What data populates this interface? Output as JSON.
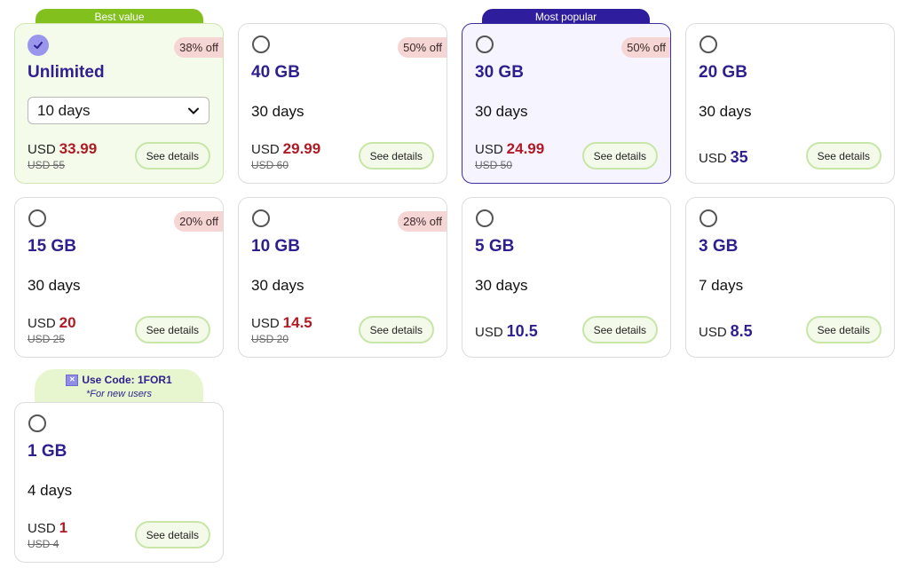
{
  "badges": {
    "best_value": "Best value",
    "most_popular": "Most popular"
  },
  "promo": {
    "code_text": "Use Code: 1FOR1",
    "note": "*For new users",
    "icon": "close-icon"
  },
  "common": {
    "currency": "USD",
    "details_label": "See details"
  },
  "plans": [
    {
      "name": "Unlimited",
      "duration_selected": "10 days",
      "price": "33.99",
      "old_price": "USD 55",
      "discount": "38% off",
      "selected": true
    },
    {
      "name": "40 GB",
      "duration": "30 days",
      "price": "29.99",
      "old_price": "USD 60",
      "discount": "50% off"
    },
    {
      "name": "30 GB",
      "duration": "30 days",
      "price": "24.99",
      "old_price": "USD 50",
      "discount": "50% off"
    },
    {
      "name": "20 GB",
      "duration": "30 days",
      "price": "35"
    },
    {
      "name": "15 GB",
      "duration": "30 days",
      "price": "20",
      "old_price": "USD 25",
      "discount": "20% off"
    },
    {
      "name": "10 GB",
      "duration": "30 days",
      "price": "14.5",
      "old_price": "USD 20",
      "discount": "28% off"
    },
    {
      "name": "5 GB",
      "duration": "30 days",
      "price": "10.5"
    },
    {
      "name": "3 GB",
      "duration": "7 days",
      "price": "8.5"
    },
    {
      "name": "1 GB",
      "duration": "4 days",
      "price": "1",
      "old_price": "USD 4"
    }
  ],
  "colors": {
    "brand_purple": "#2d1f8e",
    "badge_green": "#82c01e",
    "badge_purple": "#2e1d9c",
    "discount_red": "#b01a24",
    "discount_bg": "#f6d6d4"
  }
}
